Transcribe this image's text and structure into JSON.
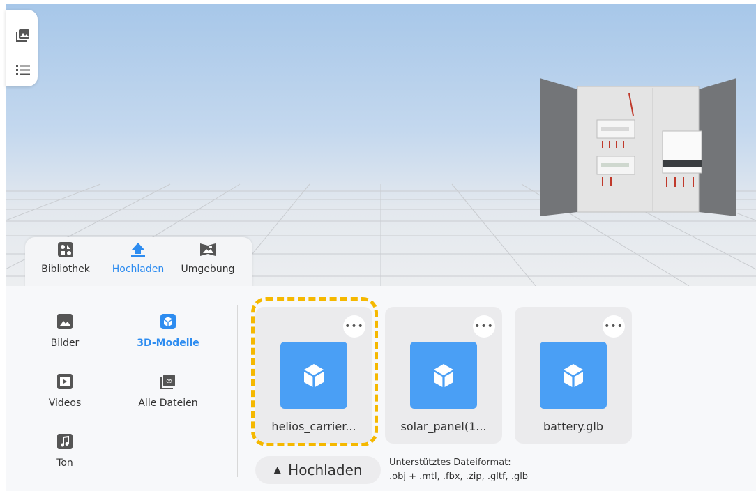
{
  "toolbar": {
    "icons": [
      "gallery-icon",
      "list-icon"
    ]
  },
  "asset_tabs": [
    {
      "label": "Bibliothek",
      "icon": "library-icon",
      "active": false
    },
    {
      "label": "Hochladen",
      "icon": "upload-icon",
      "active": true
    },
    {
      "label": "Umgebung",
      "icon": "environment-icon",
      "active": false
    }
  ],
  "categories": [
    {
      "label": "Bilder",
      "icon": "image-icon",
      "active": false
    },
    {
      "label": "3D-Modelle",
      "icon": "cube-icon",
      "active": true
    },
    {
      "label": "Videos",
      "icon": "video-icon",
      "active": false
    },
    {
      "label": "Alle Dateien",
      "icon": "all-files-icon",
      "active": false
    },
    {
      "label": "Ton",
      "icon": "music-icon",
      "active": false
    }
  ],
  "files": [
    {
      "name": "helios_carrier...",
      "icon": "cube-icon"
    },
    {
      "name": "solar_panel(1...",
      "icon": "cube-icon"
    },
    {
      "name": "battery.glb",
      "icon": "cube-icon"
    }
  ],
  "upload": {
    "label": "Hochladen",
    "formats_title": "Unterstütztes Dateiformat:",
    "formats_list": ".obj + .mtl, .fbx, .zip, .gltf, .glb"
  },
  "colors": {
    "accent": "#2d8cf0",
    "thumb": "#4a9ff5",
    "highlight": "#f5b800"
  }
}
